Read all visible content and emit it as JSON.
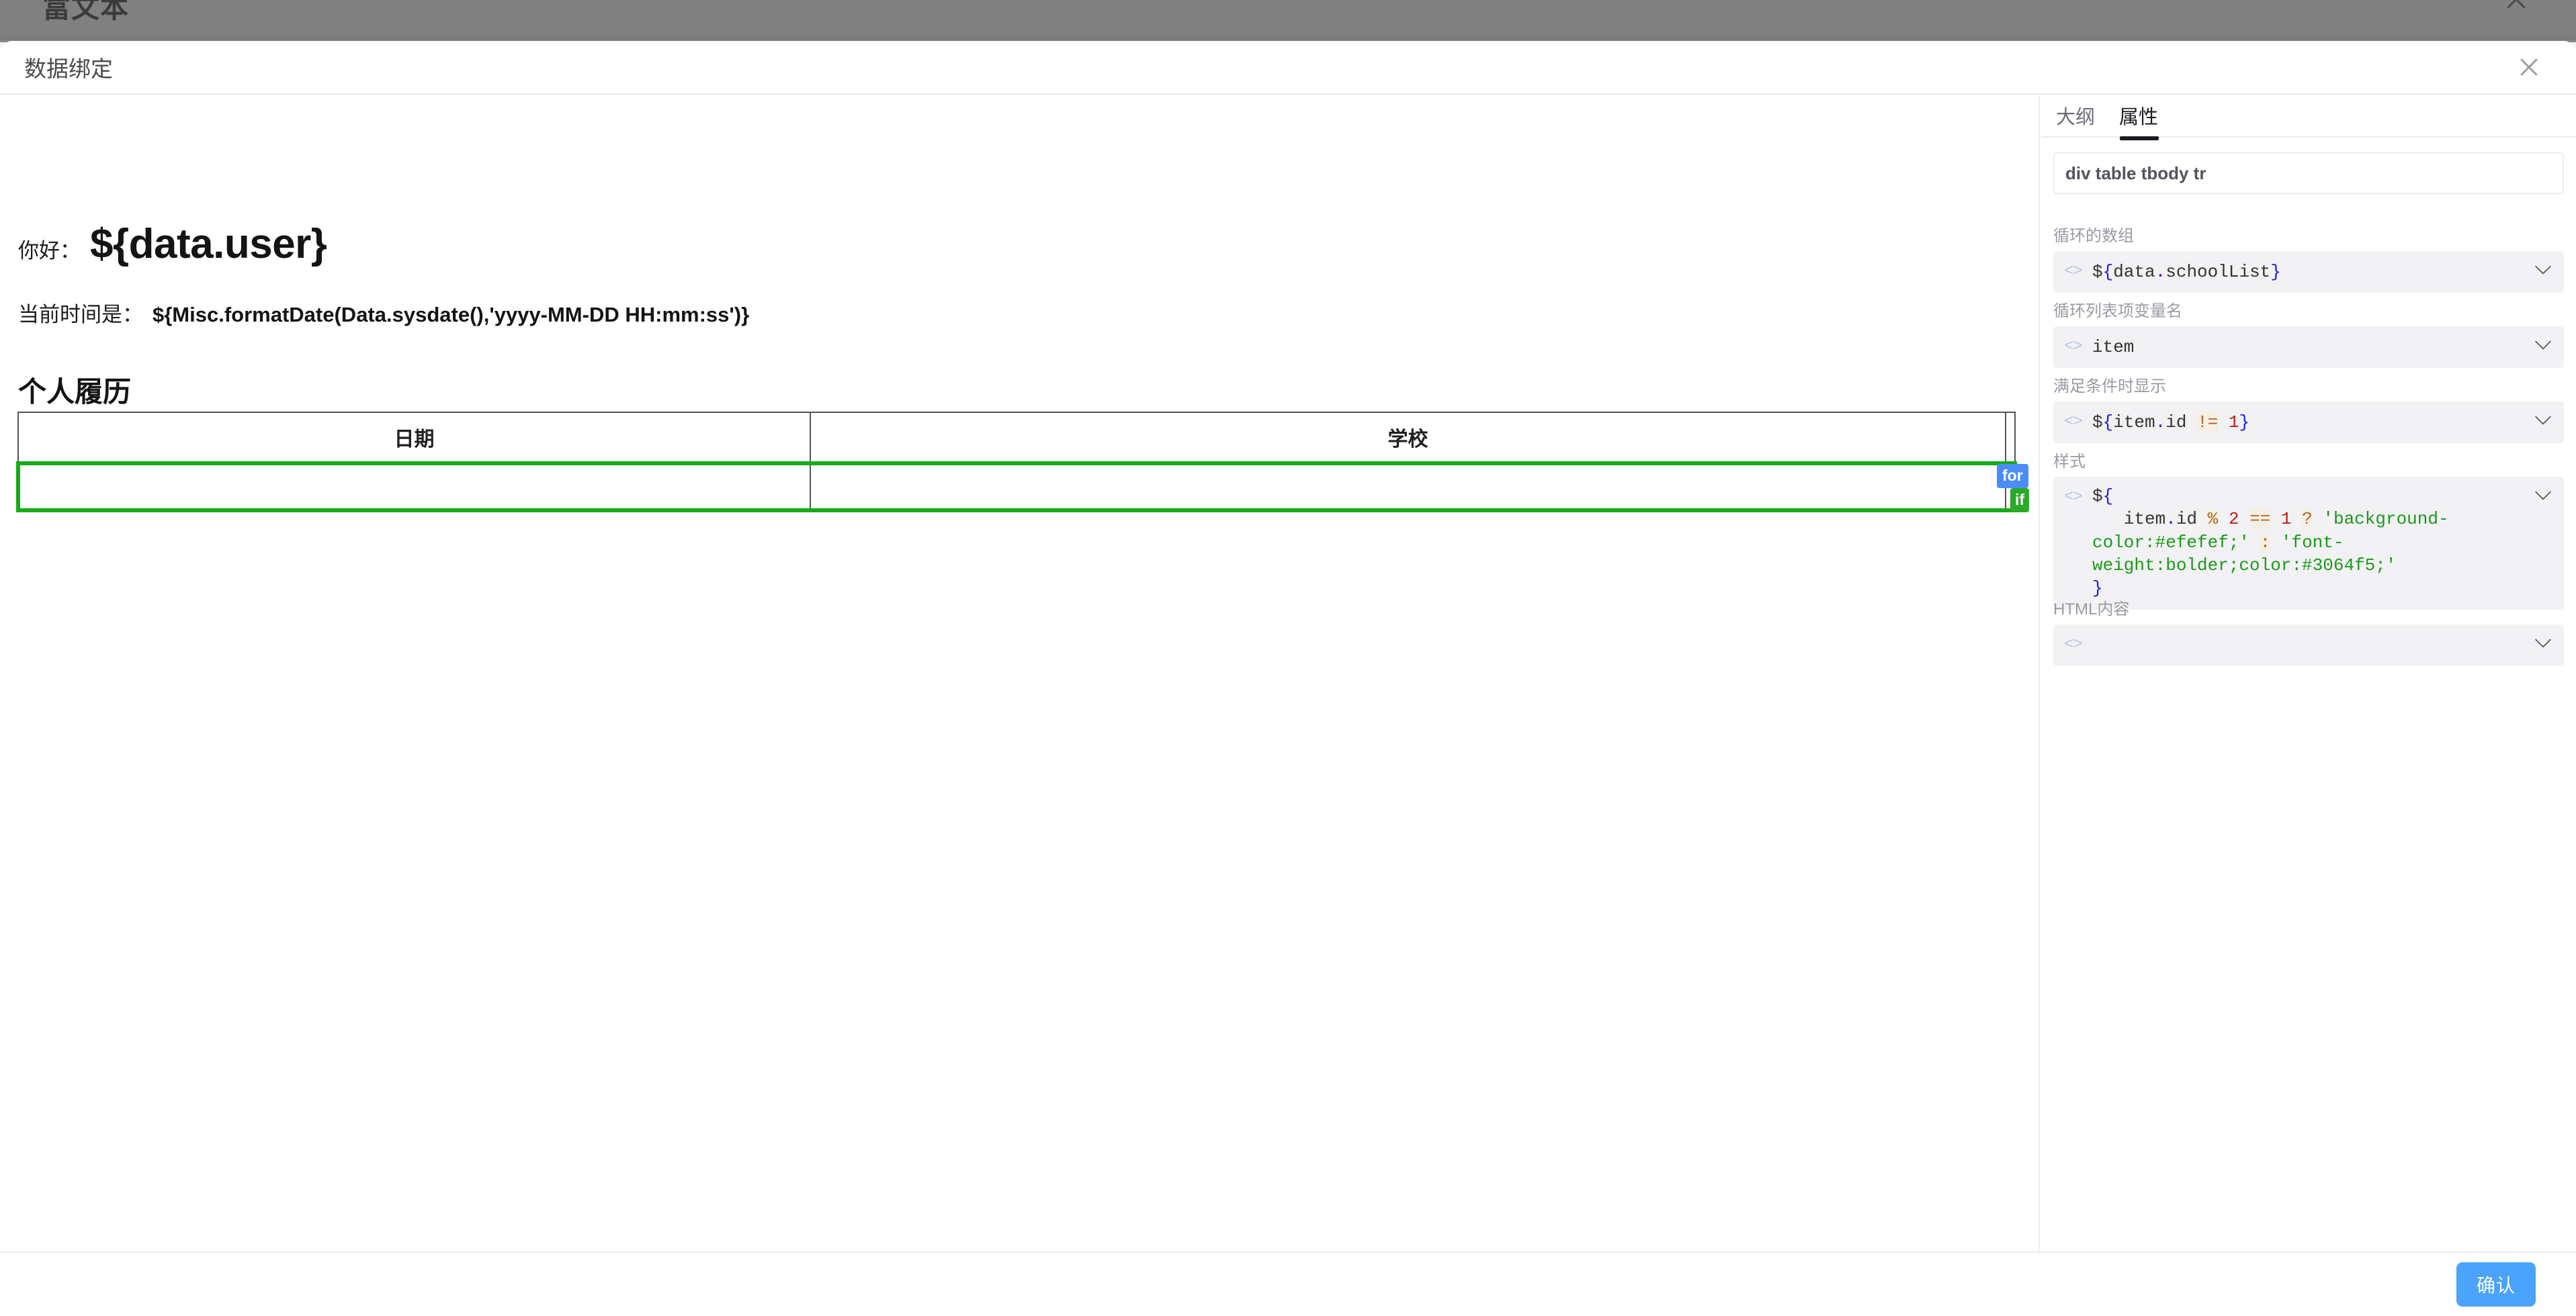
{
  "backdrop": {
    "page_title": "富文本",
    "close_icon": "close-icon"
  },
  "dialog": {
    "title": "数据绑定",
    "close_icon": "close-icon"
  },
  "canvas": {
    "greeting_label": "你好：",
    "greeting_value": "${data.user}",
    "time_label": "当前时间是：",
    "time_value": "${Misc.formatDate(Data.sysdate(),'yyyy-MM-DD HH:mm:ss')}",
    "section_title": "个人履历",
    "table": {
      "headers": [
        "日期",
        "学校",
        ""
      ],
      "rows": [
        [
          "",
          "",
          ""
        ]
      ]
    },
    "badges": [
      {
        "label": "for",
        "color": "#4b8df8"
      },
      {
        "label": "if",
        "color": "#2aa92a"
      }
    ]
  },
  "panel": {
    "tabs": [
      {
        "label": "大纲",
        "active": false
      },
      {
        "label": "属性",
        "active": true
      }
    ],
    "selector": "div table tbody tr",
    "fields": [
      {
        "label": "循环的数组",
        "value": "${data.schoolList}",
        "tokens": [
          {
            "t": "$",
            "c": "tk-plain"
          },
          {
            "t": "{",
            "c": "tk-brace"
          },
          {
            "t": "data",
            "c": "tk-plain"
          },
          {
            "t": ".",
            "c": "tk-dot"
          },
          {
            "t": "schoolList",
            "c": "tk-plain"
          },
          {
            "t": "}",
            "c": "tk-brace"
          }
        ]
      },
      {
        "label": "循环列表项变量名",
        "value": "item",
        "tokens": [
          {
            "t": "item",
            "c": "tk-plain"
          }
        ]
      },
      {
        "label": "满足条件时显示",
        "value": "${item.id != 1}",
        "tokens": [
          {
            "t": "$",
            "c": "tk-plain"
          },
          {
            "t": "{",
            "c": "tk-brace"
          },
          {
            "t": "item",
            "c": "tk-plain"
          },
          {
            "t": ".",
            "c": "tk-dot"
          },
          {
            "t": "id ",
            "c": "tk-plain"
          },
          {
            "t": "!=",
            "c": "tk-op"
          },
          {
            "t": " ",
            "c": "tk-plain"
          },
          {
            "t": "1",
            "c": "tk-num"
          },
          {
            "t": "}",
            "c": "tk-brace"
          }
        ]
      },
      {
        "label": "样式",
        "value": "${\n  item.id % 2 == 1 ? 'background-color:#efefef;' : 'font-weight:bolder;color:#3064f5;'\n}",
        "tokens": [
          {
            "t": "$",
            "c": "tk-plain"
          },
          {
            "t": "{",
            "c": "tk-brace"
          },
          {
            "t": "\n   item",
            "c": "tk-plain"
          },
          {
            "t": ".",
            "c": "tk-dot"
          },
          {
            "t": "id ",
            "c": "tk-plain"
          },
          {
            "t": "%",
            "c": "tk-op"
          },
          {
            "t": " ",
            "c": "tk-plain"
          },
          {
            "t": "2",
            "c": "tk-num"
          },
          {
            "t": " ",
            "c": "tk-plain"
          },
          {
            "t": "==",
            "c": "tk-op"
          },
          {
            "t": " ",
            "c": "tk-plain"
          },
          {
            "t": "1",
            "c": "tk-num"
          },
          {
            "t": " ",
            "c": "tk-plain"
          },
          {
            "t": "?",
            "c": "tk-q"
          },
          {
            "t": " ",
            "c": "tk-plain"
          },
          {
            "t": "'background-color:#efefef;'",
            "c": "tk-str"
          },
          {
            "t": " ",
            "c": "tk-plain"
          },
          {
            "t": ":",
            "c": "tk-q"
          },
          {
            "t": " ",
            "c": "tk-plain"
          },
          {
            "t": "'font-weight:bolder;color:#3064f5;'",
            "c": "tk-str"
          },
          {
            "t": "\n",
            "c": "tk-plain"
          },
          {
            "t": "}",
            "c": "tk-brace"
          }
        ]
      },
      {
        "label": "HTML内容",
        "value": "",
        "tokens": []
      }
    ]
  },
  "footer": {
    "confirm_label": "确认"
  },
  "colors": {
    "accent": "#4ba3fb",
    "selection_green": "#17ab17",
    "badge_for": "#4b8df8",
    "badge_if": "#2aa92a",
    "panel_field_bg": "#f2f2f4"
  }
}
